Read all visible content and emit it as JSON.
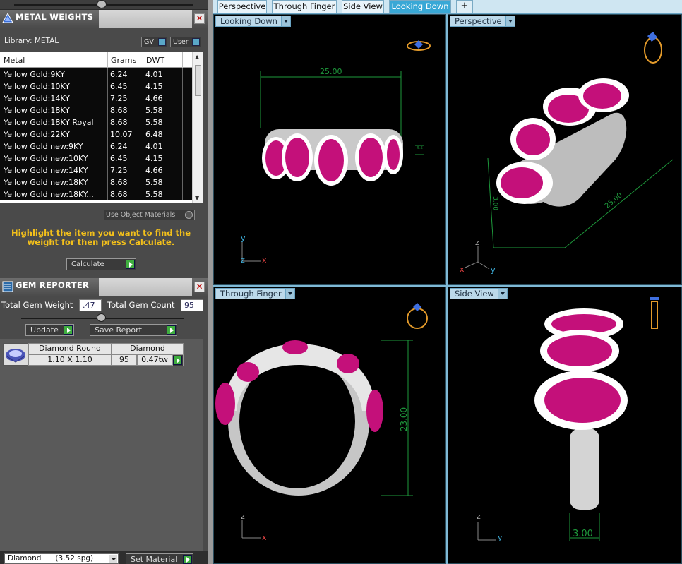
{
  "metal_panel": {
    "title": "METAL WEIGHTS",
    "library_label": "Library: METAL",
    "gv_label": "GV",
    "user_label": "User",
    "columns": [
      "Metal",
      "Grams",
      "DWT"
    ],
    "rows": [
      {
        "metal": "Yellow Gold:9KY",
        "grams": "6.24",
        "dwt": "4.01"
      },
      {
        "metal": "Yellow Gold:10KY",
        "grams": "6.45",
        "dwt": "4.15"
      },
      {
        "metal": "Yellow Gold:14KY",
        "grams": "7.25",
        "dwt": "4.66"
      },
      {
        "metal": "Yellow Gold:18KY",
        "grams": "8.68",
        "dwt": "5.58"
      },
      {
        "metal": "Yellow Gold:18KY Royal",
        "grams": "8.68",
        "dwt": "5.58"
      },
      {
        "metal": "Yellow Gold:22KY",
        "grams": "10.07",
        "dwt": "6.48"
      },
      {
        "metal": "Yellow Gold new:9KY",
        "grams": "6.24",
        "dwt": "4.01"
      },
      {
        "metal": "Yellow Gold new:10KY",
        "grams": "6.45",
        "dwt": "4.15"
      },
      {
        "metal": "Yellow Gold new:14KY",
        "grams": "7.25",
        "dwt": "4.66"
      },
      {
        "metal": "Yellow Gold new:18KY",
        "grams": "8.68",
        "dwt": "5.58"
      },
      {
        "metal": "Yellow Gold new:18KY...",
        "grams": "8.68",
        "dwt": "5.58"
      }
    ],
    "use_object_materials": "Use Object Materials",
    "hint": "Highlight the item you want to find the weight for then press Calculate.",
    "calculate_label": "Calculate"
  },
  "gem_panel": {
    "title": "GEM REPORTER",
    "total_weight_label": "Total Gem Weight",
    "total_weight_value": ".47",
    "total_count_label": "Total Gem Count",
    "total_count_value": "95",
    "update_label": "Update",
    "save_report_label": "Save Report",
    "gems": [
      {
        "shape": "Diamond Round",
        "size": "1.10 X 1.10",
        "material": "Diamond",
        "count": "95",
        "weight": "0.47tw"
      }
    ]
  },
  "bottom": {
    "material_select": "Diamond      (3.52 spg)",
    "set_material_label": "Set Material"
  },
  "tabs": [
    {
      "label": "Perspective",
      "active": false
    },
    {
      "label": "Through Finger",
      "active": false
    },
    {
      "label": "Side View",
      "active": false
    },
    {
      "label": "Looking Down",
      "active": true
    }
  ],
  "viewports": {
    "top_left": {
      "label": "Looking Down",
      "dimension": "25.00",
      "small_dim": "5.5"
    },
    "top_right": {
      "label": "Perspective",
      "dimension_a": "25.00",
      "dimension_b": "3.00"
    },
    "bottom_left": {
      "label": "Through Finger",
      "dimension": "23.00"
    },
    "bottom_right": {
      "label": "Side View",
      "dimension": "3.00"
    }
  },
  "axes": {
    "x": "x",
    "y": "y",
    "z": "z"
  },
  "colors": {
    "accent": "#39a8d6",
    "hint_text": "#f3c01b",
    "ruby": "#c4107a",
    "dimension_green": "#1e9a3c",
    "go_button": "#3fae3f"
  }
}
